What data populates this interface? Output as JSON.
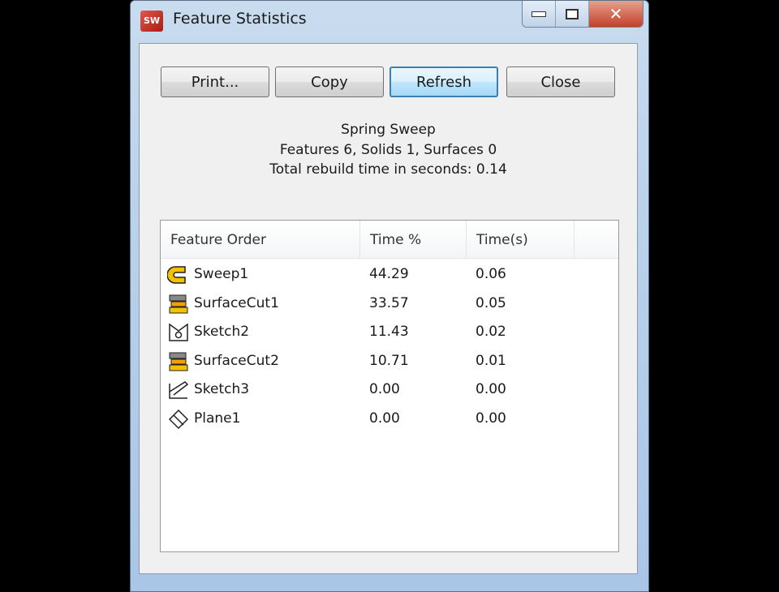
{
  "window": {
    "title": "Feature Statistics",
    "app_icon": "solidworks-icon",
    "controls": [
      "minimize",
      "maximize",
      "close"
    ]
  },
  "buttons": {
    "print": "Print...",
    "copy": "Copy",
    "refresh": "Refresh",
    "close": "Close"
  },
  "summary": {
    "name": "Spring Sweep",
    "counts": "Features 6, Solids 1, Surfaces 0",
    "rebuild": "Total rebuild time in seconds: 0.14"
  },
  "table": {
    "headers": [
      "Feature Order",
      "Time %",
      "Time(s)"
    ],
    "rows": [
      {
        "icon": "sweep-icon",
        "name": "Sweep1",
        "pct": "44.29",
        "time": "0.06"
      },
      {
        "icon": "surface-cut-icon",
        "name": "SurfaceCut1",
        "pct": "33.57",
        "time": "0.05"
      },
      {
        "icon": "sketch-icon",
        "name": "Sketch2",
        "pct": "11.43",
        "time": "0.02"
      },
      {
        "icon": "surface-cut-icon",
        "name": "SurfaceCut2",
        "pct": "10.71",
        "time": "0.01"
      },
      {
        "icon": "sketch-icon",
        "name": "Sketch3",
        "pct": "0.00",
        "time": "0.00"
      },
      {
        "icon": "plane-icon",
        "name": "Plane1",
        "pct": "0.00",
        "time": "0.00"
      }
    ]
  }
}
